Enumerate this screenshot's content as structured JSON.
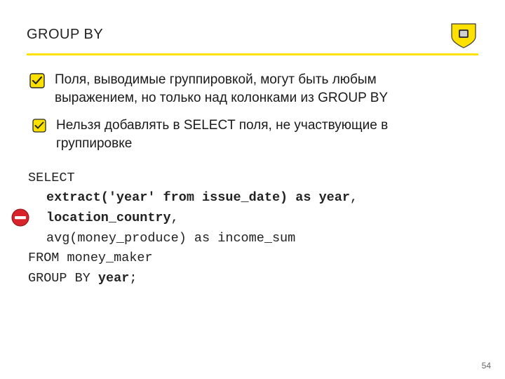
{
  "header": {
    "title": "GROUP BY"
  },
  "bullets": {
    "b1": "Поля, выводимые группировкой, могут быть любым выражением, но только над колонками из GROUP BY",
    "b2": "Нельзя добавлять в SELECT поля, не участвующие в  группировке"
  },
  "code": {
    "l1": "SELECT",
    "l2a": "extract('year' from issue_date)",
    "l2b": " as year",
    "l2c": ",",
    "l3a": "location_country",
    "l3b": ",",
    "l4": "avg(money_produce) as income_sum",
    "l5": "FROM money_maker",
    "l6a": "GROUP BY ",
    "l6b": "year",
    "l6c": ";"
  },
  "page": "54"
}
